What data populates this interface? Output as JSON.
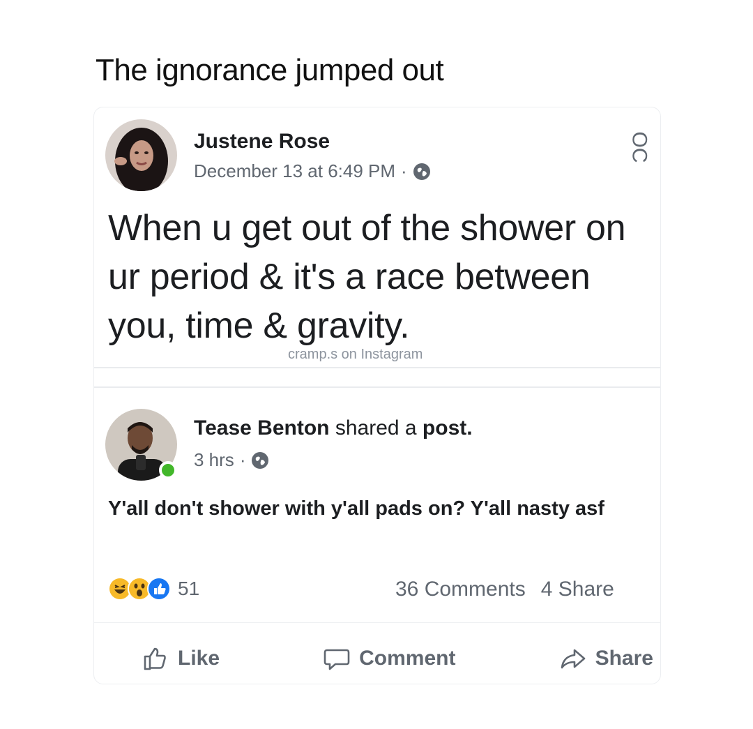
{
  "caption": "The ignorance jumped out",
  "original_post": {
    "author": "Justene Rose",
    "timestamp": "December 13 at 6:49 PM",
    "separator": "·",
    "text": "When u get out of the shower on ur period & it's a race between you, time & gravity.",
    "watermark": "cramp.s on Instagram",
    "corner_mark": "OC",
    "privacy_icon": "globe-icon"
  },
  "share": {
    "author": "Tease Benton",
    "action_text": " shared a ",
    "object_text": "post.",
    "timestamp": "3 hrs",
    "separator": "·",
    "privacy_icon": "globe-icon",
    "text": "Y'all don't shower with y'all pads on? Y'all nasty asf"
  },
  "engagement": {
    "reactions": [
      "haha",
      "wow",
      "like"
    ],
    "reaction_count": "51",
    "comments": "36 Comments",
    "shares": "4 Share"
  },
  "actions": {
    "like": "Like",
    "comment": "Comment",
    "share": "Share"
  },
  "colors": {
    "text_primary": "#1c1e21",
    "text_secondary": "#606770",
    "like_blue": "#1877f2",
    "reaction_yellow": "#f7b928",
    "online_green": "#42b72a"
  }
}
